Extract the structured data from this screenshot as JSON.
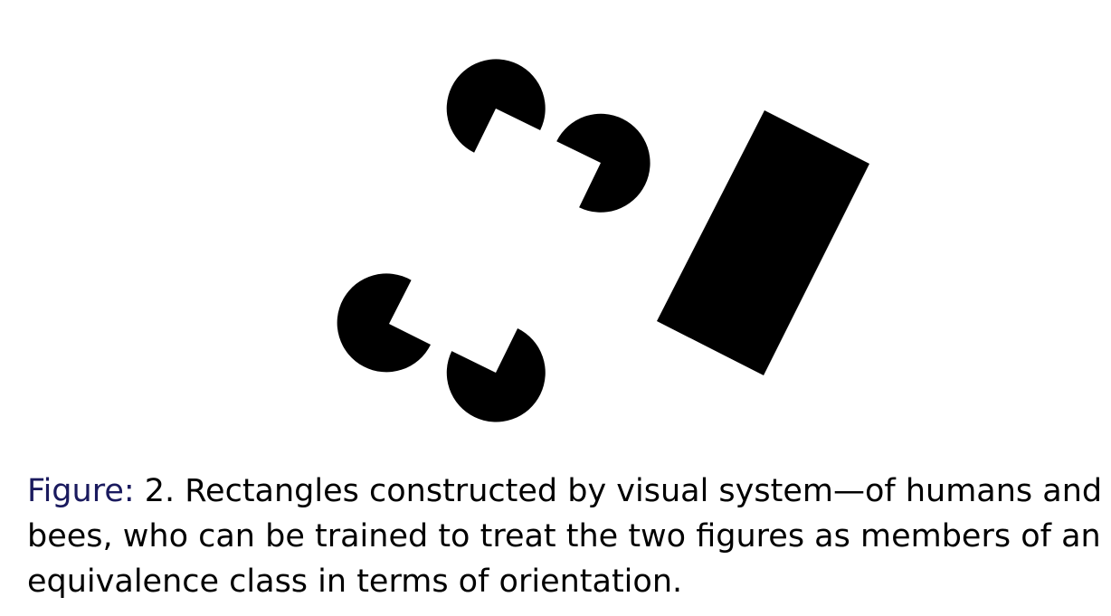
{
  "colors": {
    "shape_fill": "#000000",
    "background": "#ffffff",
    "caption_label": "#1a1a5e",
    "caption_text": "#000000"
  },
  "caption": {
    "label": "Figure:",
    "text": " 2. Rectangles constructed by visual system—of humans and bees, who can be trained to treat the two figures as members of an equivalence class in terms of orientation."
  }
}
